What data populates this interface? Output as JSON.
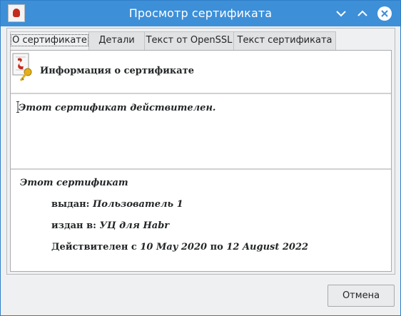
{
  "window": {
    "title": "Просмотр сертификата"
  },
  "tabs": [
    {
      "label": "О сертификате",
      "active": true
    },
    {
      "label": "Детали",
      "active": false
    },
    {
      "label": "Текст от OpenSSL",
      "active": false
    },
    {
      "label": "Текст сертификата",
      "active": false
    }
  ],
  "header": {
    "title": "Информация о сертификате"
  },
  "status": {
    "text": "Этот сертификат действителен."
  },
  "details": {
    "intro": "Этот сертификат",
    "issued_to_label": "выдан:",
    "issued_to_value": "Пользователь 1",
    "issued_by_label": "издан в:",
    "issued_by_value": "УЦ для Habr",
    "valid_label": "Действителен с",
    "valid_from": "10 May 2020",
    "valid_mid": "по",
    "valid_to": "12 August 2022"
  },
  "footer": {
    "cancel_label": "Отмена"
  },
  "colors": {
    "titlebar": "#3d8fd8",
    "seal": "#c42b1c",
    "key": "#e3b01b"
  },
  "icons": {
    "titlebar_app": "certificate-icon",
    "minimize": "chevron-down-icon",
    "maximize": "chevron-up-icon",
    "close": "close-icon",
    "header": "certificate-key-icon"
  }
}
